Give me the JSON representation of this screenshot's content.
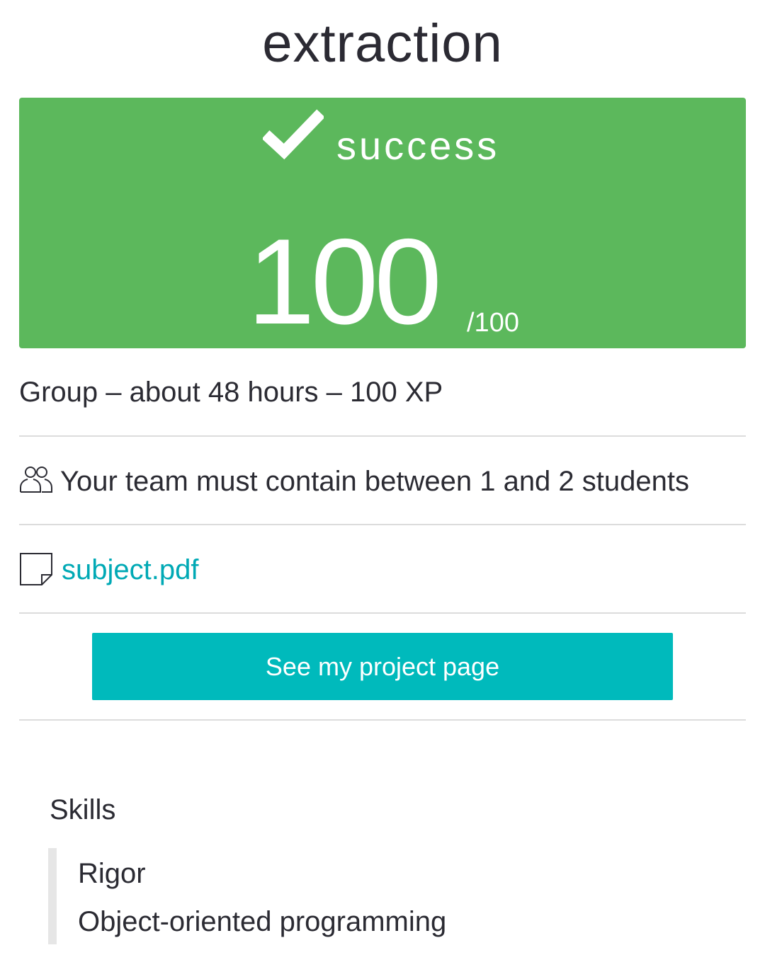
{
  "project": {
    "title": "extraction"
  },
  "result": {
    "status": "success",
    "score": "100",
    "max_score": "/100",
    "color": "#5cb85c",
    "icon": "checkmark-icon"
  },
  "meta": {
    "summary": "Group – about 48 hours – 100 XP"
  },
  "team": {
    "icon": "team-icon",
    "text": "Your team must contain between 1 and 2 students"
  },
  "subject": {
    "icon": "document-icon",
    "link_text": "subject.pdf",
    "link_color": "#00a9b5"
  },
  "actions": {
    "project_page_label": "See my project page",
    "button_color": "#00babc"
  },
  "skills": {
    "title": "Skills",
    "items": [
      "Rigor",
      "Object-oriented programming"
    ]
  }
}
